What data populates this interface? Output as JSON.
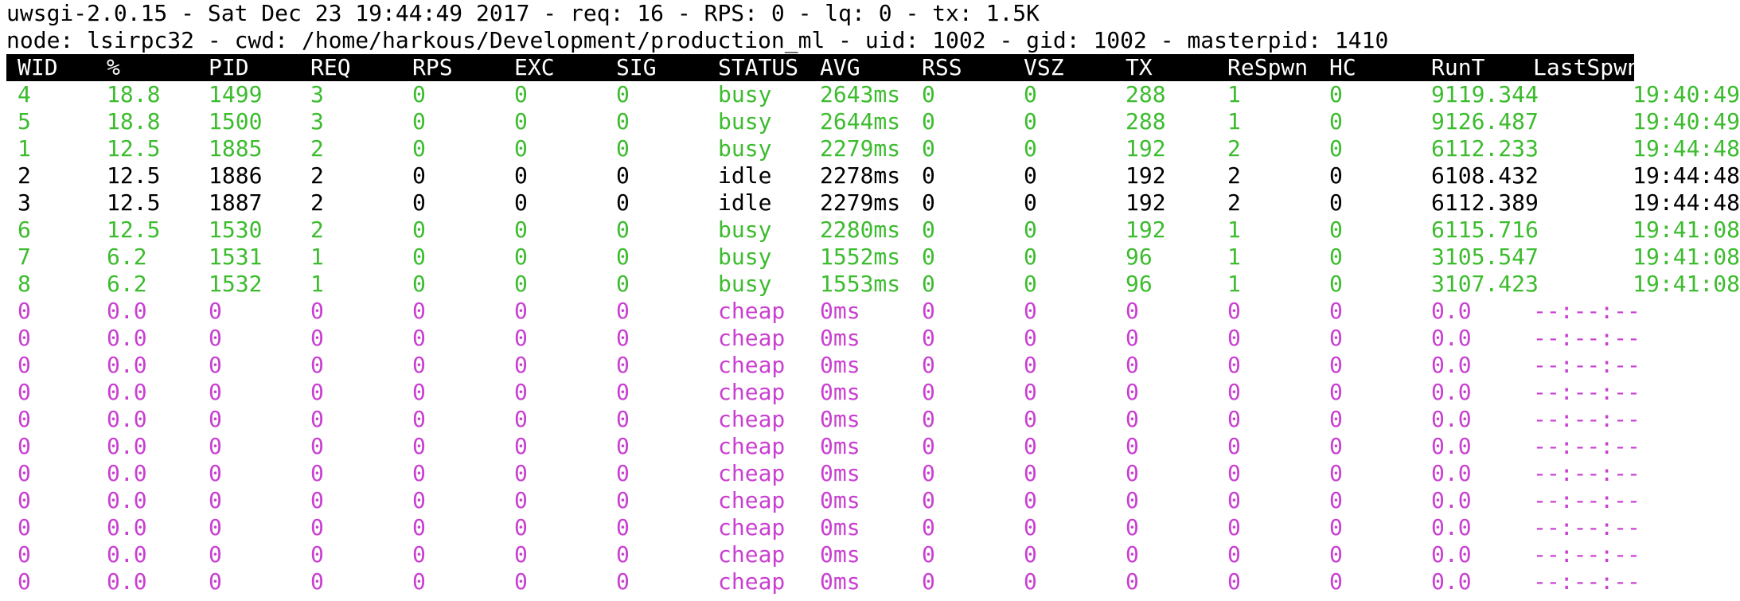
{
  "status_line_1": "uwsgi-2.0.15 - Sat Dec 23 19:44:49 2017 - req: 16 - RPS: 0 - lq: 0 - tx: 1.5K",
  "status_line_2": "node: lsirpc32 - cwd: /home/harkous/Development/production_ml - uid: 1002 - gid: 1002 - masterpid: 1410",
  "columns": [
    "WID",
    "%",
    "PID",
    "REQ",
    "RPS",
    "EXC",
    "SIG",
    "STATUS",
    "AVG",
    "RSS",
    "VSZ",
    "TX",
    "ReSpwn",
    "HC",
    "RunT",
    "LastSpwn"
  ],
  "colors": {
    "busy": "#3cbc2e",
    "idle": "#000000",
    "cheap": "#c93fd1",
    "header_bg": "#000000",
    "header_fg": "#ffffff"
  },
  "workers": [
    {
      "state": "busy",
      "cells": [
        "4",
        "18.8",
        "1499",
        "3",
        "0",
        "0",
        "0",
        "busy",
        "2643ms",
        "0",
        "0",
        "288",
        "1",
        "0",
        "9119.344",
        "19:40:49"
      ]
    },
    {
      "state": "busy",
      "cells": [
        "5",
        "18.8",
        "1500",
        "3",
        "0",
        "0",
        "0",
        "busy",
        "2644ms",
        "0",
        "0",
        "288",
        "1",
        "0",
        "9126.487",
        "19:40:49"
      ]
    },
    {
      "state": "busy",
      "cells": [
        "1",
        "12.5",
        "1885",
        "2",
        "0",
        "0",
        "0",
        "busy",
        "2279ms",
        "0",
        "0",
        "192",
        "2",
        "0",
        "6112.233",
        "19:44:48"
      ]
    },
    {
      "state": "idle",
      "cells": [
        "2",
        "12.5",
        "1886",
        "2",
        "0",
        "0",
        "0",
        "idle",
        "2278ms",
        "0",
        "0",
        "192",
        "2",
        "0",
        "6108.432",
        "19:44:48"
      ]
    },
    {
      "state": "idle",
      "cells": [
        "3",
        "12.5",
        "1887",
        "2",
        "0",
        "0",
        "0",
        "idle",
        "2279ms",
        "0",
        "0",
        "192",
        "2",
        "0",
        "6112.389",
        "19:44:48"
      ]
    },
    {
      "state": "busy",
      "cells": [
        "6",
        "12.5",
        "1530",
        "2",
        "0",
        "0",
        "0",
        "busy",
        "2280ms",
        "0",
        "0",
        "192",
        "1",
        "0",
        "6115.716",
        "19:41:08"
      ]
    },
    {
      "state": "busy",
      "cells": [
        "7",
        "6.2",
        "1531",
        "1",
        "0",
        "0",
        "0",
        "busy",
        "1552ms",
        "0",
        "0",
        "96",
        "1",
        "0",
        "3105.547",
        "19:41:08"
      ]
    },
    {
      "state": "busy",
      "cells": [
        "8",
        "6.2",
        "1532",
        "1",
        "0",
        "0",
        "0",
        "busy",
        "1553ms",
        "0",
        "0",
        "96",
        "1",
        "0",
        "3107.423",
        "19:41:08"
      ]
    },
    {
      "state": "cheap",
      "cells": [
        "0",
        "0.0",
        "0",
        "0",
        "0",
        "0",
        "0",
        "cheap",
        "0ms",
        "0",
        "0",
        "0",
        "0",
        "0",
        "0.0",
        "--:--:--"
      ]
    },
    {
      "state": "cheap",
      "cells": [
        "0",
        "0.0",
        "0",
        "0",
        "0",
        "0",
        "0",
        "cheap",
        "0ms",
        "0",
        "0",
        "0",
        "0",
        "0",
        "0.0",
        "--:--:--"
      ]
    },
    {
      "state": "cheap",
      "cells": [
        "0",
        "0.0",
        "0",
        "0",
        "0",
        "0",
        "0",
        "cheap",
        "0ms",
        "0",
        "0",
        "0",
        "0",
        "0",
        "0.0",
        "--:--:--"
      ]
    },
    {
      "state": "cheap",
      "cells": [
        "0",
        "0.0",
        "0",
        "0",
        "0",
        "0",
        "0",
        "cheap",
        "0ms",
        "0",
        "0",
        "0",
        "0",
        "0",
        "0.0",
        "--:--:--"
      ]
    },
    {
      "state": "cheap",
      "cells": [
        "0",
        "0.0",
        "0",
        "0",
        "0",
        "0",
        "0",
        "cheap",
        "0ms",
        "0",
        "0",
        "0",
        "0",
        "0",
        "0.0",
        "--:--:--"
      ]
    },
    {
      "state": "cheap",
      "cells": [
        "0",
        "0.0",
        "0",
        "0",
        "0",
        "0",
        "0",
        "cheap",
        "0ms",
        "0",
        "0",
        "0",
        "0",
        "0",
        "0.0",
        "--:--:--"
      ]
    },
    {
      "state": "cheap",
      "cells": [
        "0",
        "0.0",
        "0",
        "0",
        "0",
        "0",
        "0",
        "cheap",
        "0ms",
        "0",
        "0",
        "0",
        "0",
        "0",
        "0.0",
        "--:--:--"
      ]
    },
    {
      "state": "cheap",
      "cells": [
        "0",
        "0.0",
        "0",
        "0",
        "0",
        "0",
        "0",
        "cheap",
        "0ms",
        "0",
        "0",
        "0",
        "0",
        "0",
        "0.0",
        "--:--:--"
      ]
    },
    {
      "state": "cheap",
      "cells": [
        "0",
        "0.0",
        "0",
        "0",
        "0",
        "0",
        "0",
        "cheap",
        "0ms",
        "0",
        "0",
        "0",
        "0",
        "0",
        "0.0",
        "--:--:--"
      ]
    },
    {
      "state": "cheap",
      "cells": [
        "0",
        "0.0",
        "0",
        "0",
        "0",
        "0",
        "0",
        "cheap",
        "0ms",
        "0",
        "0",
        "0",
        "0",
        "0",
        "0.0",
        "--:--:--"
      ]
    },
    {
      "state": "cheap",
      "cells": [
        "0",
        "0.0",
        "0",
        "0",
        "0",
        "0",
        "0",
        "cheap",
        "0ms",
        "0",
        "0",
        "0",
        "0",
        "0",
        "0.0",
        "--:--:--"
      ]
    }
  ]
}
